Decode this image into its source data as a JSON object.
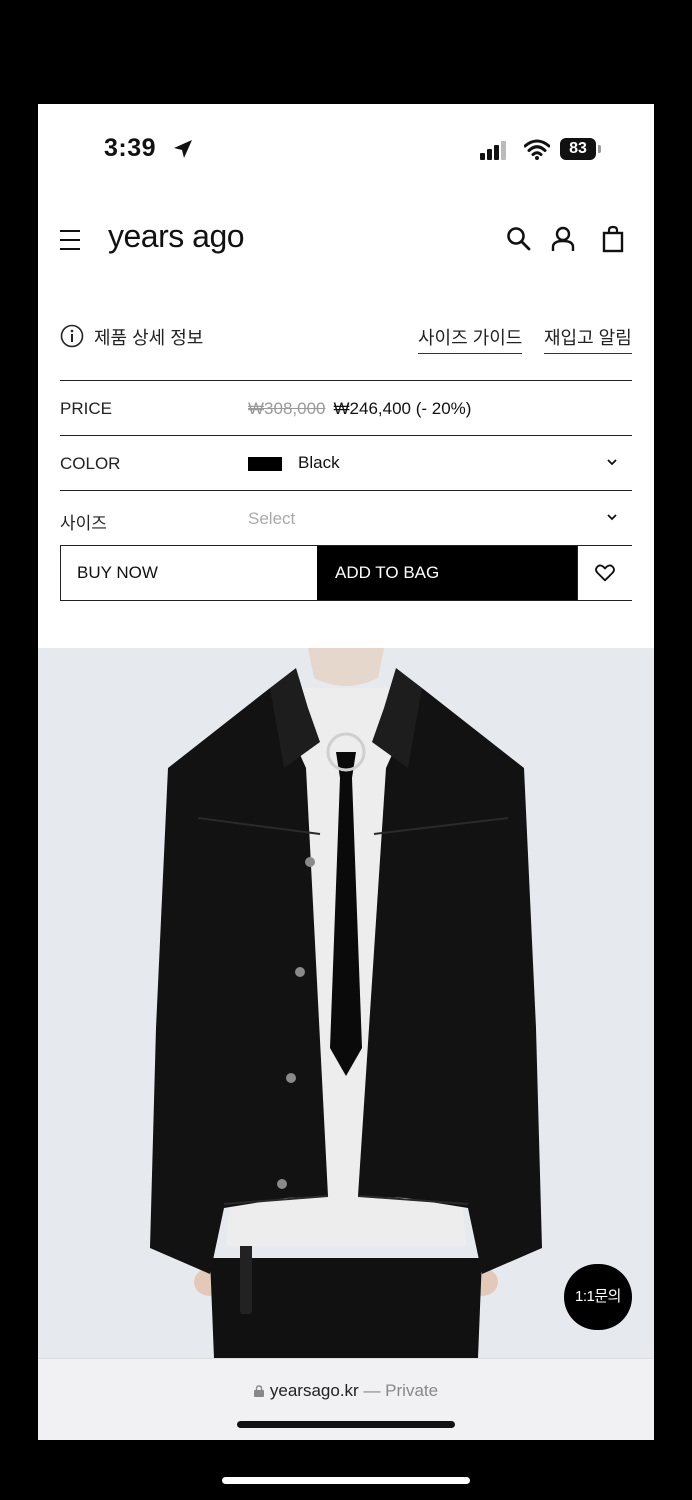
{
  "status": {
    "time": "3:39",
    "battery": "83"
  },
  "header": {
    "logo": "years ago"
  },
  "info": {
    "label": "제품 상세 정보",
    "size_guide": "사이즈 가이드",
    "restock_alert": "재입고 알림"
  },
  "price": {
    "label": "PRICE",
    "original": "₩308,000",
    "sale": "₩246,400 (- 20%)"
  },
  "color": {
    "label": "COLOR",
    "value": "Black",
    "swatch": "#000000"
  },
  "size": {
    "label": "사이즈",
    "placeholder": "Select"
  },
  "actions": {
    "buy_now": "BUY NOW",
    "add_to_bag": "ADD TO BAG"
  },
  "chat": {
    "label": "1:1문의"
  },
  "browser": {
    "domain": "yearsago.kr",
    "mode": "— Private"
  },
  "icons": [
    "location-arrow-icon",
    "signal-icon",
    "wifi-icon",
    "battery-icon",
    "menu-icon",
    "search-icon",
    "account-icon",
    "bag-icon",
    "info-icon",
    "chevron-down-icon",
    "heart-icon",
    "lock-icon"
  ]
}
